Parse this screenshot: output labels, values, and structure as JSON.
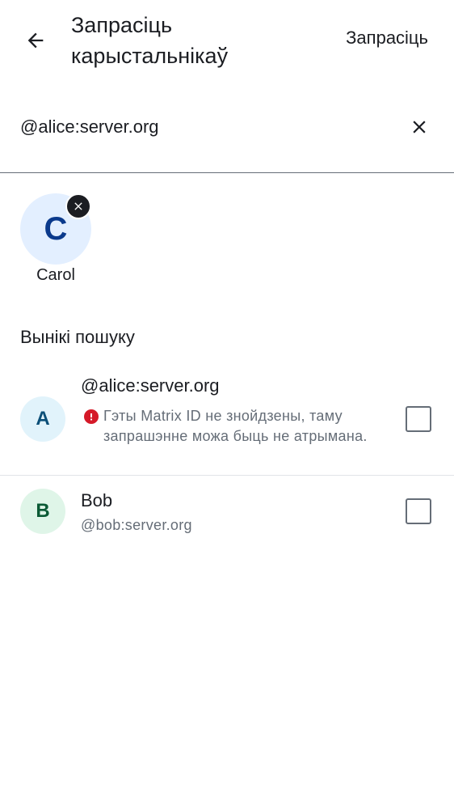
{
  "topbar": {
    "title": "Запрасіць карыстальнікаў",
    "action_label": "Запрасіць",
    "back_icon": "arrow-left-icon"
  },
  "search": {
    "value": "@alice:server.org",
    "clear_icon": "close-icon"
  },
  "selected": [
    {
      "initial": "C",
      "name": "Carol",
      "remove_icon": "close-icon"
    }
  ],
  "results": {
    "header": "Вынікі пошуку",
    "items": [
      {
        "initial": "A",
        "name": "@alice:server.org",
        "warning_icon": "error-icon",
        "warning": "Гэты Matrix ID не знойдзены, таму запрашэнне можа быць не атрымана.",
        "checked": false
      },
      {
        "initial": "B",
        "name": "Bob",
        "subtitle": "@bob:server.org",
        "checked": false
      }
    ]
  },
  "colors": {
    "accent_text": "#1b1d22",
    "secondary_text": "#656d77",
    "error": "#d51928",
    "avatar_c_bg": "#e3efff",
    "avatar_a_bg": "#e1f3fb",
    "avatar_b_bg": "#dff5e8"
  }
}
